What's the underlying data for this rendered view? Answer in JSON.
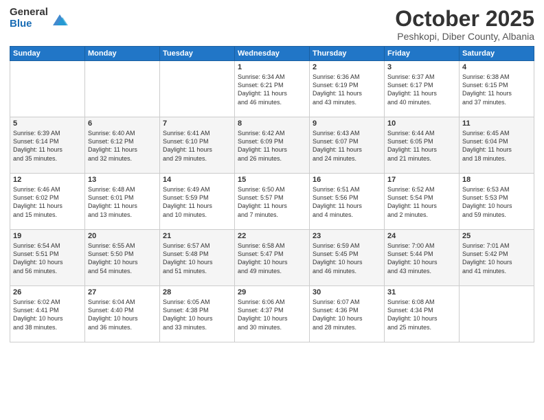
{
  "header": {
    "logo": {
      "general": "General",
      "blue": "Blue"
    },
    "title": "October 2025",
    "subtitle": "Peshkopi, Diber County, Albania"
  },
  "days_of_week": [
    "Sunday",
    "Monday",
    "Tuesday",
    "Wednesday",
    "Thursday",
    "Friday",
    "Saturday"
  ],
  "weeks": [
    {
      "row_class": "row-odd",
      "days": [
        {
          "number": "",
          "info": ""
        },
        {
          "number": "",
          "info": ""
        },
        {
          "number": "",
          "info": ""
        },
        {
          "number": "1",
          "info": "Sunrise: 6:34 AM\nSunset: 6:21 PM\nDaylight: 11 hours\nand 46 minutes."
        },
        {
          "number": "2",
          "info": "Sunrise: 6:36 AM\nSunset: 6:19 PM\nDaylight: 11 hours\nand 43 minutes."
        },
        {
          "number": "3",
          "info": "Sunrise: 6:37 AM\nSunset: 6:17 PM\nDaylight: 11 hours\nand 40 minutes."
        },
        {
          "number": "4",
          "info": "Sunrise: 6:38 AM\nSunset: 6:15 PM\nDaylight: 11 hours\nand 37 minutes."
        }
      ]
    },
    {
      "row_class": "row-even",
      "days": [
        {
          "number": "5",
          "info": "Sunrise: 6:39 AM\nSunset: 6:14 PM\nDaylight: 11 hours\nand 35 minutes."
        },
        {
          "number": "6",
          "info": "Sunrise: 6:40 AM\nSunset: 6:12 PM\nDaylight: 11 hours\nand 32 minutes."
        },
        {
          "number": "7",
          "info": "Sunrise: 6:41 AM\nSunset: 6:10 PM\nDaylight: 11 hours\nand 29 minutes."
        },
        {
          "number": "8",
          "info": "Sunrise: 6:42 AM\nSunset: 6:09 PM\nDaylight: 11 hours\nand 26 minutes."
        },
        {
          "number": "9",
          "info": "Sunrise: 6:43 AM\nSunset: 6:07 PM\nDaylight: 11 hours\nand 24 minutes."
        },
        {
          "number": "10",
          "info": "Sunrise: 6:44 AM\nSunset: 6:05 PM\nDaylight: 11 hours\nand 21 minutes."
        },
        {
          "number": "11",
          "info": "Sunrise: 6:45 AM\nSunset: 6:04 PM\nDaylight: 11 hours\nand 18 minutes."
        }
      ]
    },
    {
      "row_class": "row-odd",
      "days": [
        {
          "number": "12",
          "info": "Sunrise: 6:46 AM\nSunset: 6:02 PM\nDaylight: 11 hours\nand 15 minutes."
        },
        {
          "number": "13",
          "info": "Sunrise: 6:48 AM\nSunset: 6:01 PM\nDaylight: 11 hours\nand 13 minutes."
        },
        {
          "number": "14",
          "info": "Sunrise: 6:49 AM\nSunset: 5:59 PM\nDaylight: 11 hours\nand 10 minutes."
        },
        {
          "number": "15",
          "info": "Sunrise: 6:50 AM\nSunset: 5:57 PM\nDaylight: 11 hours\nand 7 minutes."
        },
        {
          "number": "16",
          "info": "Sunrise: 6:51 AM\nSunset: 5:56 PM\nDaylight: 11 hours\nand 4 minutes."
        },
        {
          "number": "17",
          "info": "Sunrise: 6:52 AM\nSunset: 5:54 PM\nDaylight: 11 hours\nand 2 minutes."
        },
        {
          "number": "18",
          "info": "Sunrise: 6:53 AM\nSunset: 5:53 PM\nDaylight: 10 hours\nand 59 minutes."
        }
      ]
    },
    {
      "row_class": "row-even",
      "days": [
        {
          "number": "19",
          "info": "Sunrise: 6:54 AM\nSunset: 5:51 PM\nDaylight: 10 hours\nand 56 minutes."
        },
        {
          "number": "20",
          "info": "Sunrise: 6:55 AM\nSunset: 5:50 PM\nDaylight: 10 hours\nand 54 minutes."
        },
        {
          "number": "21",
          "info": "Sunrise: 6:57 AM\nSunset: 5:48 PM\nDaylight: 10 hours\nand 51 minutes."
        },
        {
          "number": "22",
          "info": "Sunrise: 6:58 AM\nSunset: 5:47 PM\nDaylight: 10 hours\nand 49 minutes."
        },
        {
          "number": "23",
          "info": "Sunrise: 6:59 AM\nSunset: 5:45 PM\nDaylight: 10 hours\nand 46 minutes."
        },
        {
          "number": "24",
          "info": "Sunrise: 7:00 AM\nSunset: 5:44 PM\nDaylight: 10 hours\nand 43 minutes."
        },
        {
          "number": "25",
          "info": "Sunrise: 7:01 AM\nSunset: 5:42 PM\nDaylight: 10 hours\nand 41 minutes."
        }
      ]
    },
    {
      "row_class": "row-odd",
      "days": [
        {
          "number": "26",
          "info": "Sunrise: 6:02 AM\nSunset: 4:41 PM\nDaylight: 10 hours\nand 38 minutes."
        },
        {
          "number": "27",
          "info": "Sunrise: 6:04 AM\nSunset: 4:40 PM\nDaylight: 10 hours\nand 36 minutes."
        },
        {
          "number": "28",
          "info": "Sunrise: 6:05 AM\nSunset: 4:38 PM\nDaylight: 10 hours\nand 33 minutes."
        },
        {
          "number": "29",
          "info": "Sunrise: 6:06 AM\nSunset: 4:37 PM\nDaylight: 10 hours\nand 30 minutes."
        },
        {
          "number": "30",
          "info": "Sunrise: 6:07 AM\nSunset: 4:36 PM\nDaylight: 10 hours\nand 28 minutes."
        },
        {
          "number": "31",
          "info": "Sunrise: 6:08 AM\nSunset: 4:34 PM\nDaylight: 10 hours\nand 25 minutes."
        },
        {
          "number": "",
          "info": ""
        }
      ]
    }
  ]
}
